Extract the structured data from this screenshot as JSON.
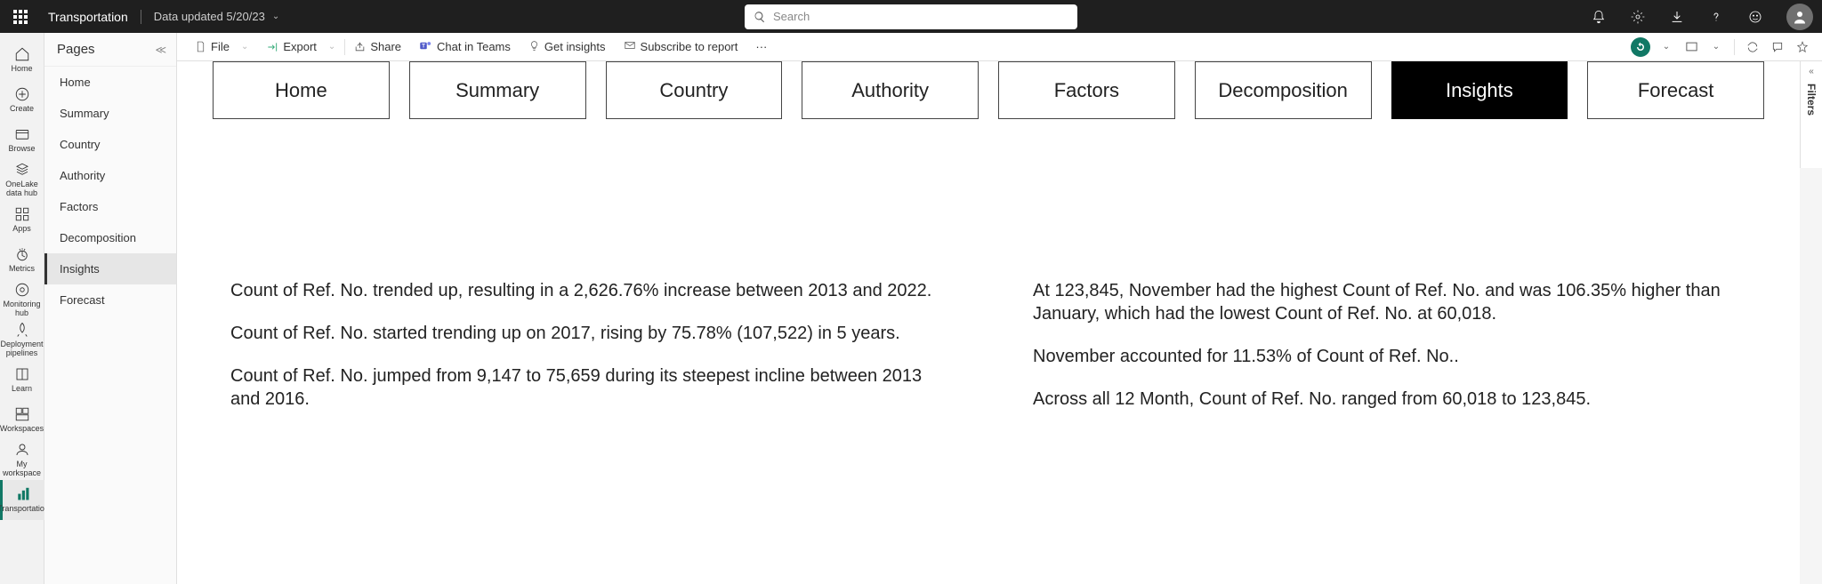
{
  "topbar": {
    "title": "Transportation",
    "subtitle": "Data updated 5/20/23",
    "search_placeholder": "Search"
  },
  "leftrail": [
    {
      "label": "Home"
    },
    {
      "label": "Create"
    },
    {
      "label": "Browse"
    },
    {
      "label": "OneLake data hub"
    },
    {
      "label": "Apps"
    },
    {
      "label": "Metrics"
    },
    {
      "label": "Monitoring hub"
    },
    {
      "label": "Deployment pipelines"
    },
    {
      "label": "Learn"
    },
    {
      "label": "Workspaces"
    },
    {
      "label": "My workspace"
    },
    {
      "label": "Transportation"
    }
  ],
  "pages": {
    "header": "Pages",
    "items": [
      "Home",
      "Summary",
      "Country",
      "Authority",
      "Factors",
      "Decomposition",
      "Insights",
      "Forecast"
    ],
    "selected": "Insights"
  },
  "toolbar": {
    "file": "File",
    "export": "Export",
    "share": "Share",
    "chat": "Chat in Teams",
    "insights": "Get insights",
    "subscribe": "Subscribe to report"
  },
  "report": {
    "nav": [
      "Home",
      "Summary",
      "Country",
      "Authority",
      "Factors",
      "Decomposition",
      "Insights",
      "Forecast"
    ],
    "active_nav": "Insights",
    "left_paragraphs": [
      "Count of Ref. No. trended up, resulting in a 2,626.76% increase between 2013 and 2022.",
      "Count of Ref. No. started trending up on 2017, rising by 75.78% (107,522) in 5 years.",
      "Count of Ref. No. jumped from 9,147 to 75,659 during its steepest incline between 2013 and 2016."
    ],
    "right_paragraphs": [
      "At 123,845, November had the highest Count of Ref. No. and was 106.35% higher than January, which had the lowest Count of Ref. No. at 60,018.",
      "November accounted for 11.53% of Count of Ref. No..",
      "Across all 12 Month, Count of Ref. No. ranged from 60,018 to 123,845."
    ]
  },
  "filters": {
    "label": "Filters"
  }
}
